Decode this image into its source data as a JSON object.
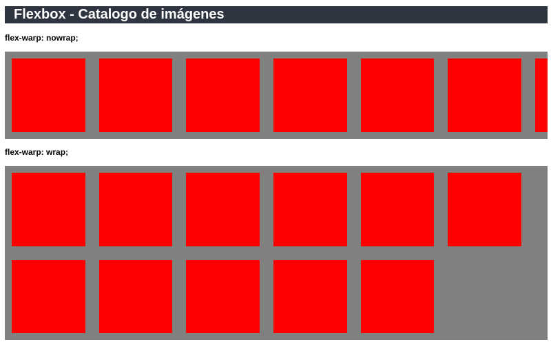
{
  "header": {
    "title": "Flexbox - Catalogo de imágenes"
  },
  "sections": {
    "nowrap": {
      "label": "flex-warp: nowrap;",
      "item_count": 7
    },
    "wrap": {
      "label": "flex-warp: wrap;",
      "item_count": 11
    }
  },
  "colors": {
    "title_background": "#2e3440",
    "container_background": "#808080",
    "item_color": "#ff0000"
  }
}
